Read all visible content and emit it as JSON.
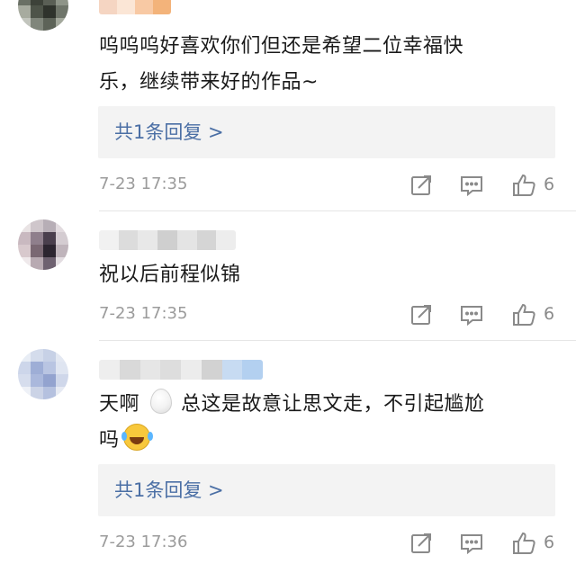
{
  "comments": [
    {
      "text_line1": "呜呜呜好喜欢你们但还是希望二位幸福快",
      "text_line2": "乐，继续带来好的作品~",
      "reply_summary": "共1条回复 >",
      "time": "7-23 17:35",
      "like_count": "6"
    },
    {
      "text_line1": "祝以后前程似锦",
      "time": "7-23 17:35",
      "like_count": "6"
    },
    {
      "text_before_emoji": "天啊",
      "text_after_emoji": "总这是故意让思文走，不引起尴尬",
      "text_line2": "吗",
      "reply_summary": "共1条回复 >",
      "time": "7-23 17:36",
      "like_count": "6"
    }
  ],
  "icons": {
    "share": "share-icon",
    "reply": "comment-icon",
    "like": "thumbs-up-icon",
    "emoji_1": "egg-emoji",
    "emoji_2": "laughing-tears-emoji"
  },
  "colors": {
    "reply_link": "#4b6fa5",
    "meta_text": "#9b9b9b",
    "reply_box_bg": "#f3f3f3"
  }
}
